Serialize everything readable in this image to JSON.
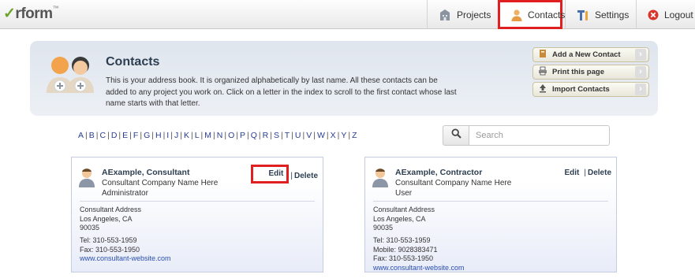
{
  "app": {
    "logo_text": "rform",
    "logo_check": "✓",
    "logo_tm": "™"
  },
  "nav": {
    "projects": "Projects",
    "contacts": "Contacts",
    "settings": "Settings",
    "logout": "Logout"
  },
  "header": {
    "title": "Contacts",
    "description": "This is your address book. It is organized alphabetically by last name. All these contacts can be added to any project you work on. Click on a letter in the index to scroll to the first contact whose last name starts with that letter.",
    "add_contact": "Add a New Contact",
    "print_page": "Print this page",
    "import_contacts": "Import Contacts"
  },
  "alphabet": [
    "A",
    "B",
    "C",
    "D",
    "E",
    "F",
    "G",
    "H",
    "I",
    "J",
    "K",
    "L",
    "M",
    "N",
    "O",
    "P",
    "Q",
    "R",
    "S",
    "T",
    "U",
    "V",
    "W",
    "X",
    "Y",
    "Z"
  ],
  "search": {
    "placeholder": "Search"
  },
  "contacts": [
    {
      "name": "AExample, Consultant",
      "company": "Consultant Company Name Here",
      "role": "Administrator",
      "edit": "Edit",
      "pipe": "|",
      "delete": "Delete",
      "address1": "Consultant Address",
      "address2": "Los Angeles, CA",
      "zip": "90035",
      "tel": "Tel: 310-553-1959",
      "mobile": "",
      "fax": "Fax: 310-553-1950",
      "website": "www.consultant-website.com"
    },
    {
      "name": "AExample, Contractor",
      "company": "Consultant Company Name Here",
      "role": "User",
      "edit": "Edit",
      "pipe": "|",
      "delete": "Delete",
      "address1": "Consultant Address",
      "address2": "Los Angeles, CA",
      "zip": "90035",
      "tel": "Tel: 310-553-1959",
      "mobile": "Mobile: 9028383471",
      "fax": "Fax: 310-553-1950",
      "website": "www.consultant-website.com"
    }
  ],
  "colors": {
    "highlight": "#e02020",
    "link": "#2a4fb0",
    "title": "#2c3e50",
    "logo_check": "#6aa327"
  }
}
